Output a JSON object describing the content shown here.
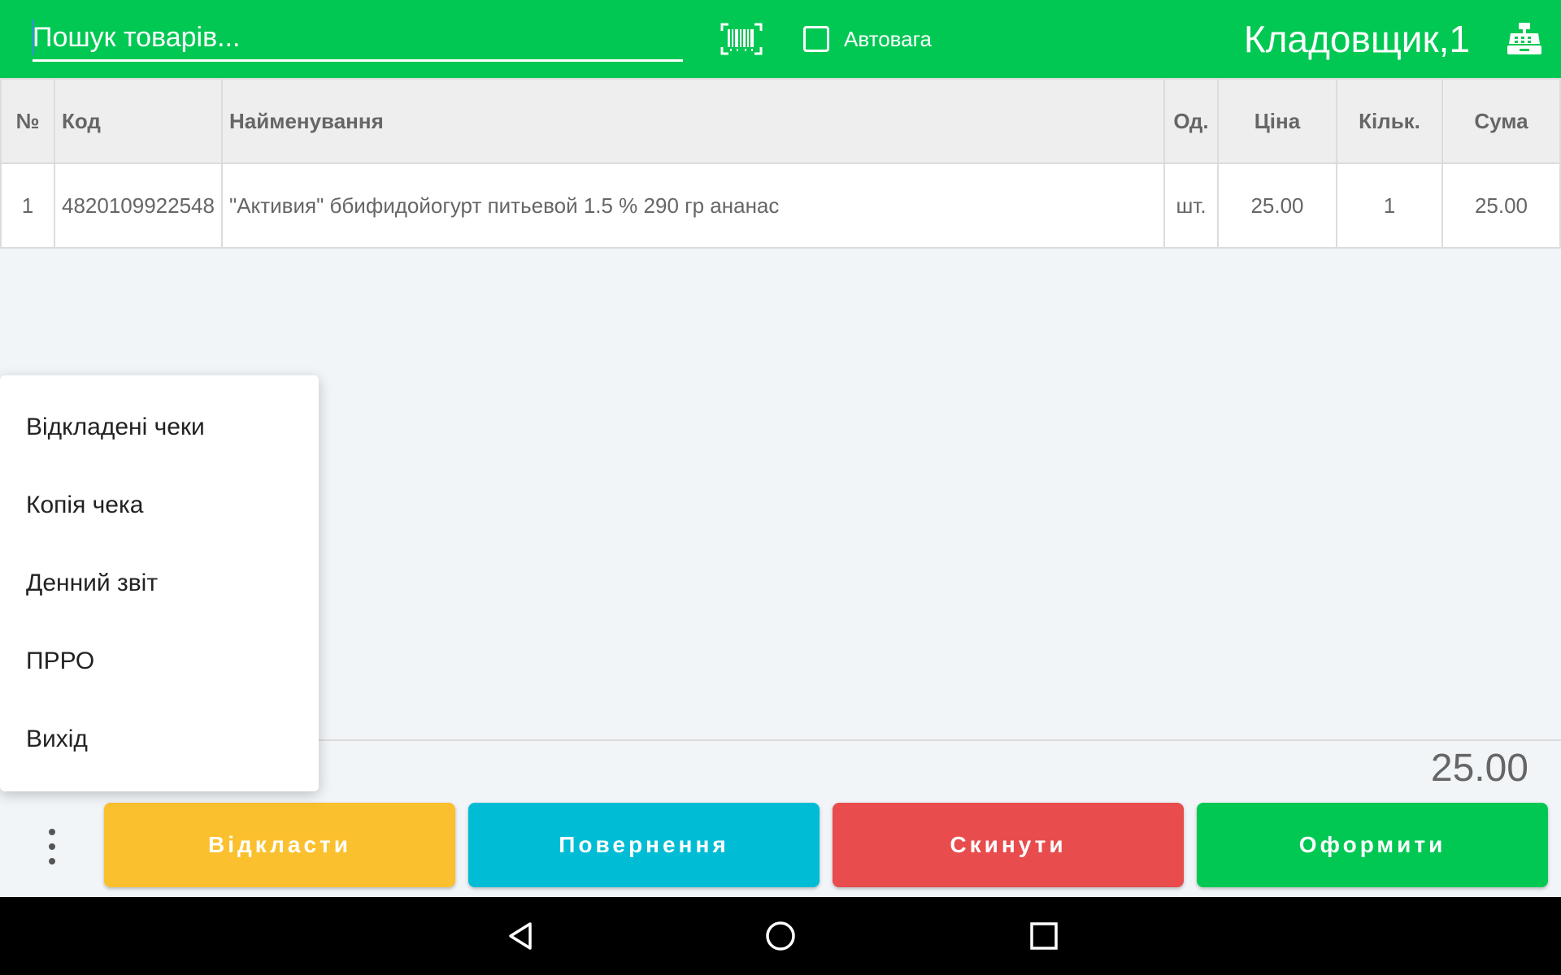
{
  "topbar": {
    "search_placeholder": "Пошук товарів...",
    "autoweight_label": "Автовага",
    "autoweight_checked": false,
    "user": "Кладовщик,1",
    "icons": [
      "barcode-scan-icon",
      "cash-register-icon"
    ],
    "color": "#00c853"
  },
  "table": {
    "headers": {
      "num": "№",
      "code": "Код",
      "name": "Найменування",
      "unit": "Од.",
      "price": "Ціна",
      "qty": "Кільк.",
      "sum": "Сума"
    },
    "rows": [
      {
        "num": "1",
        "code": "4820109922548",
        "name": "\"Активия\" ббифидойогурт питьевой 1.5 % 290 гр ананас",
        "unit": "шт.",
        "price": "25.00",
        "qty": "1",
        "sum": "25.00"
      }
    ]
  },
  "total": "25.00",
  "menu": {
    "items": [
      "Відкладені чеки",
      "Копія чека",
      "Денний звіт",
      "ПРРО",
      "Вихід"
    ]
  },
  "actions": {
    "defer": "Відкласти",
    "return": "Повернення",
    "reset": "Скинути",
    "checkout": "Оформити",
    "colors": {
      "defer": "#fbc02d",
      "return": "#00bcd4",
      "reset": "#e84c4c",
      "checkout": "#00c853"
    }
  },
  "navbar": {
    "icons": [
      "back-icon",
      "home-icon",
      "recents-icon"
    ]
  }
}
